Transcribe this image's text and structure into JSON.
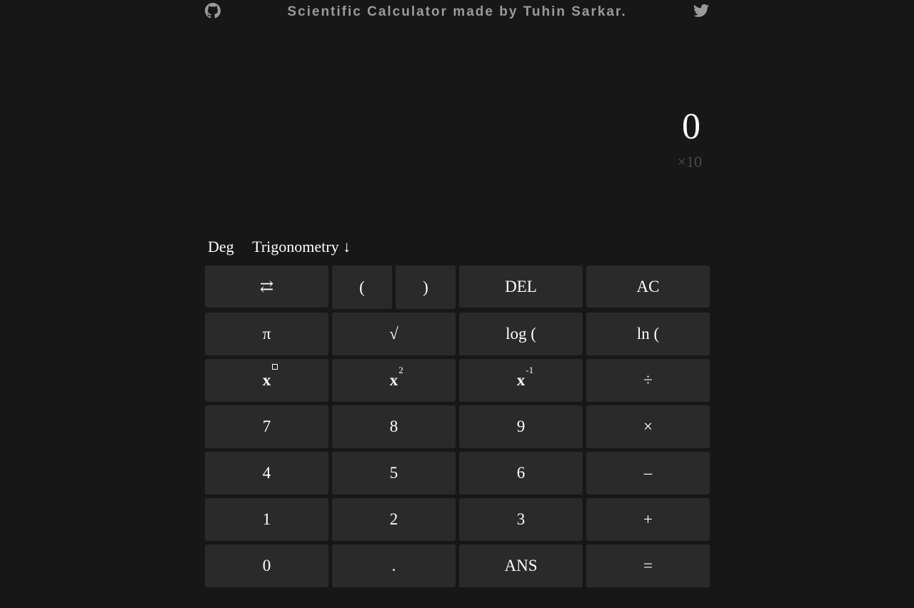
{
  "header": {
    "title": "Scientific Calculator made by Tuhin Sarkar.",
    "left_icon": "github-icon",
    "right_icon": "twitter-icon"
  },
  "display": {
    "value": "0",
    "exponent": "×10"
  },
  "modes": {
    "angle": "Deg",
    "menu": "Trigonometry ↓"
  },
  "keys": {
    "swap": "⇄",
    "open_paren": "(",
    "close_paren": ")",
    "del": "DEL",
    "ac": "AC",
    "pi": "π",
    "sqrt": "√",
    "log": "log (",
    "ln": "ln (",
    "power_base": "x",
    "square_base": "x",
    "square_sup": "2",
    "inverse_base": "x",
    "inverse_sup": "-1",
    "divide": "÷",
    "seven": "7",
    "eight": "8",
    "nine": "9",
    "multiply": "×",
    "four": "4",
    "five": "5",
    "six": "6",
    "minus": "–",
    "one": "1",
    "two": "2",
    "three": "3",
    "plus": "+",
    "zero": "0",
    "dot": ".",
    "ans": "ANS",
    "equals": "="
  },
  "colors": {
    "background": "#171717",
    "key": "#2a2a2a",
    "title": "#9a9a9a",
    "exponent": "#4a4a4a"
  }
}
